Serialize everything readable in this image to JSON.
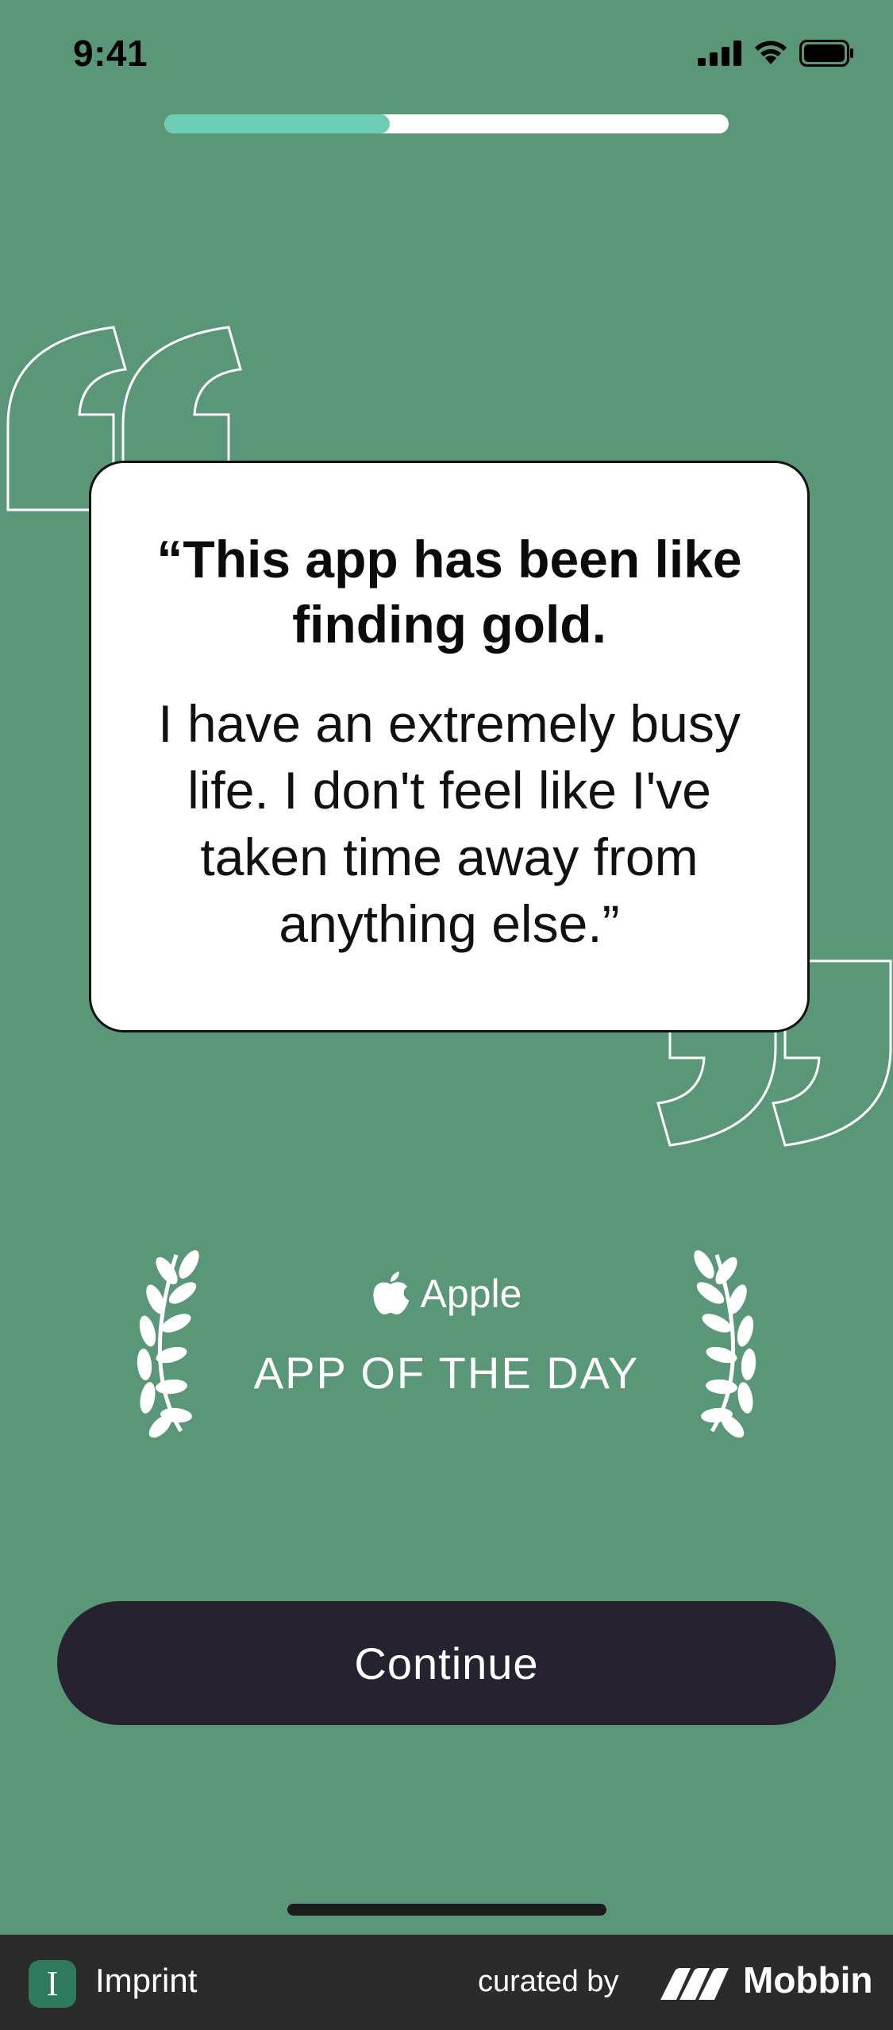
{
  "status_bar": {
    "time": "9:41"
  },
  "progress": {
    "value": 0.4
  },
  "quote": {
    "headline": "“This app has been like finding gold.",
    "body": "I have an extremely busy life. I don't feel like I've taken time away from anything else.”"
  },
  "award": {
    "brand": "Apple",
    "title": "APP OF THE DAY"
  },
  "continue_label": "Continue",
  "footer": {
    "app_icon_letter": "I",
    "app_name": "Imprint",
    "curated_by": "curated by",
    "mobbin": "Mobbin"
  },
  "colors": {
    "background": "#5a9779",
    "progress_fill": "#6ccdb4",
    "button": "#27222f",
    "footer": "#2b2b2b"
  }
}
